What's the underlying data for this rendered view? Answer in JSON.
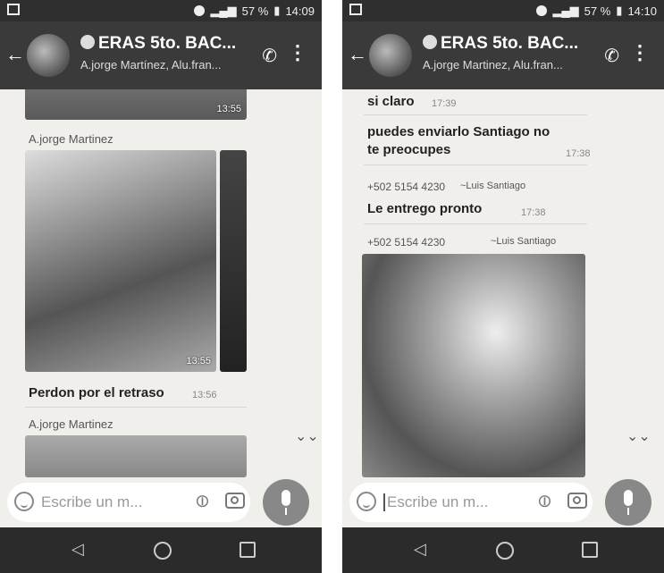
{
  "phones": [
    {
      "status": {
        "battery": "57 %",
        "time": "14:09"
      },
      "header": {
        "title": "ERAS 5to. BAC...",
        "subtitle": "A.jorge Martínez, Alu.fran..."
      },
      "messages": {
        "top_time": "13:55",
        "sender1": "A.jorge Martinez",
        "image_time": "13:55",
        "text1": "Perdon por el retraso",
        "text1_time": "13:56",
        "sender2": "A.jorge Martinez"
      },
      "input": {
        "placeholder": "Escribe un m..."
      }
    },
    {
      "status": {
        "battery": "57 %",
        "time": "14:10"
      },
      "header": {
        "title": "ERAS 5to. BAC...",
        "subtitle": "A.jorge Martinez, Alu.fran..."
      },
      "messages": {
        "text1": "si claro",
        "text1_time": "17:39",
        "text2": "puedes enviarlo Santiago no te preocupes",
        "text2_time": "17:38",
        "phone1": "+502 5154 4230",
        "name1": "~Luis Santiago",
        "text3": "Le entrego pronto",
        "text3_time": "17:38",
        "phone2": "+502 5154 4230",
        "name2": "~Luis Santiago"
      },
      "input": {
        "placeholder": "Escribe un m..."
      }
    }
  ]
}
